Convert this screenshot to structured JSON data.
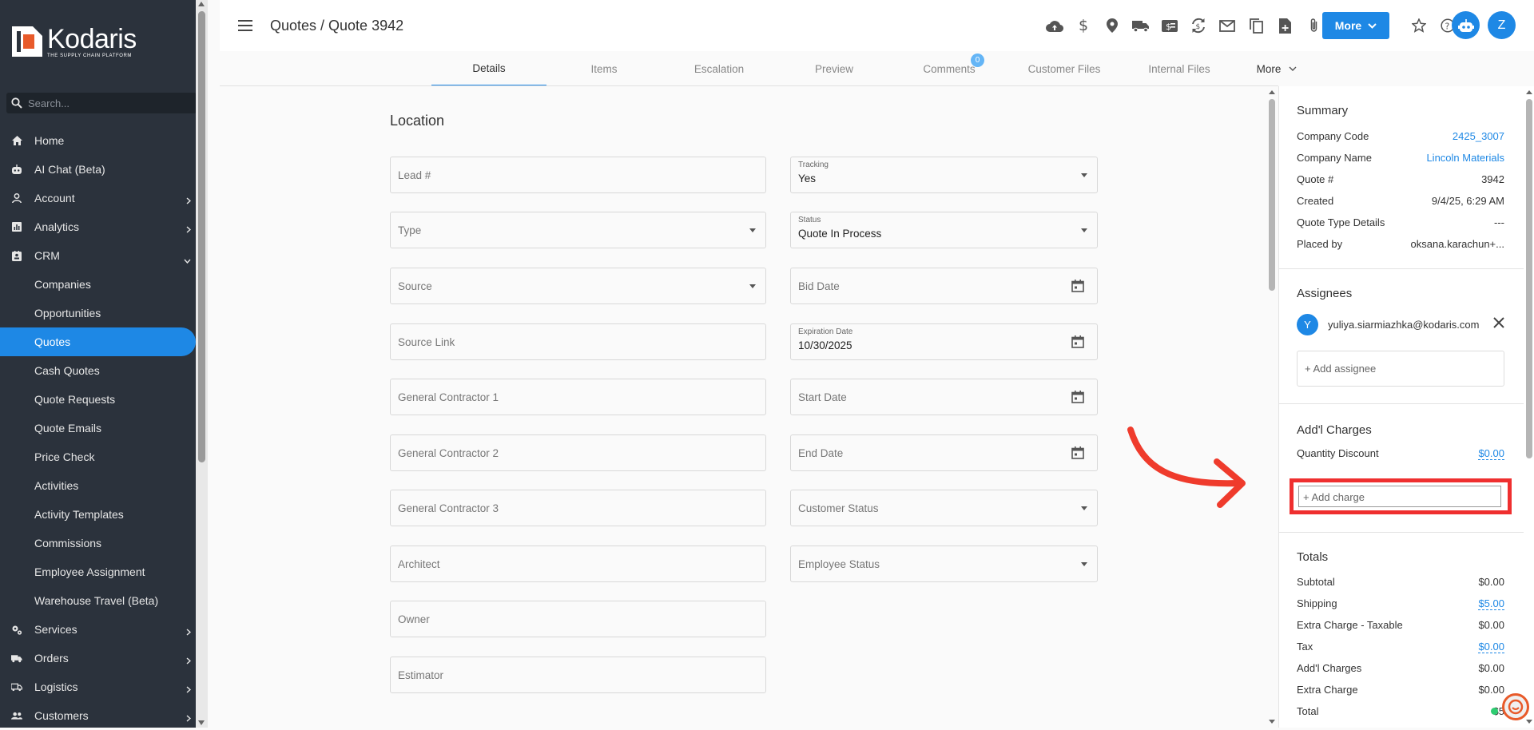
{
  "sidebar": {
    "logo_name": "Kodaris",
    "logo_tagline": "THE SUPPLY CHAIN PLATFORM",
    "search_placeholder": "Search...",
    "items": [
      {
        "label": "Home",
        "icon": "home-icon"
      },
      {
        "label": "AI Chat (Beta)",
        "icon": "robot-icon"
      },
      {
        "label": "Account",
        "icon": "person-icon"
      },
      {
        "label": "Analytics",
        "icon": "chart-icon"
      },
      {
        "label": "CRM",
        "icon": "contact-card-icon"
      }
    ],
    "crm_sub": [
      {
        "label": "Companies"
      },
      {
        "label": "Opportunities"
      },
      {
        "label": "Quotes"
      },
      {
        "label": "Cash Quotes"
      },
      {
        "label": "Quote Requests"
      },
      {
        "label": "Quote Emails"
      },
      {
        "label": "Price Check"
      },
      {
        "label": "Activities"
      },
      {
        "label": "Activity Templates"
      },
      {
        "label": "Commissions"
      },
      {
        "label": "Employee Assignment"
      },
      {
        "label": "Warehouse Travel (Beta)"
      }
    ],
    "items_after": [
      {
        "label": "Services",
        "icon": "gears-icon"
      },
      {
        "label": "Orders",
        "icon": "truck-icon"
      },
      {
        "label": "Logistics",
        "icon": "truck-icon"
      },
      {
        "label": "Customers",
        "icon": "people-icon"
      }
    ]
  },
  "header": {
    "title": "Quotes / Quote 3942",
    "more_label": "More",
    "avatar_initial": "Z"
  },
  "tabs": [
    {
      "label": "Details"
    },
    {
      "label": "Items"
    },
    {
      "label": "Escalation"
    },
    {
      "label": "Preview"
    },
    {
      "label": "Comments",
      "badge": "0"
    },
    {
      "label": "Customer Files"
    },
    {
      "label": "Internal Files"
    }
  ],
  "tabs_more": "More",
  "form": {
    "section_title": "Location",
    "left": [
      {
        "placeholder": "Lead #"
      },
      {
        "placeholder": "Type"
      },
      {
        "placeholder": "Source"
      },
      {
        "placeholder": "Source Link"
      },
      {
        "placeholder": "General Contractor 1"
      },
      {
        "placeholder": "General Contractor 2"
      },
      {
        "placeholder": "General Contractor 3"
      },
      {
        "placeholder": "Architect"
      },
      {
        "placeholder": "Owner"
      },
      {
        "placeholder": "Estimator"
      }
    ],
    "right": [
      {
        "label": "Tracking",
        "value": "Yes"
      },
      {
        "label": "Status",
        "value": "Quote In Process"
      },
      {
        "placeholder": "Bid Date"
      },
      {
        "label": "Expiration Date",
        "value": "10/30/2025"
      },
      {
        "placeholder": "Start Date"
      },
      {
        "placeholder": "End Date"
      },
      {
        "placeholder": "Customer Status"
      },
      {
        "placeholder": "Employee Status"
      }
    ]
  },
  "summary": {
    "title": "Summary",
    "rows": [
      {
        "k": "Company Code",
        "v": "2425_3007"
      },
      {
        "k": "Company Name",
        "v": "Lincoln Materials"
      },
      {
        "k": "Quote #",
        "v": "3942"
      },
      {
        "k": "Created",
        "v": "9/4/25, 6:29 AM"
      },
      {
        "k": "Quote Type Details",
        "v": "---"
      },
      {
        "k": "Placed by",
        "v": "oksana.karachun+..."
      }
    ]
  },
  "assignees": {
    "title": "Assignees",
    "initial": "Y",
    "email": "yuliya.siarmiazhka@kodaris.com",
    "add_placeholder": "+ Add assignee"
  },
  "charges": {
    "title": "Add'l Charges",
    "row_label": "Quantity Discount",
    "row_value": "$0.00",
    "add_placeholder": "+ Add charge"
  },
  "totals": {
    "title": "Totals",
    "rows": [
      {
        "k": "Subtotal",
        "v": "$0.00"
      },
      {
        "k": "Shipping",
        "v": "$5.00"
      },
      {
        "k": "Extra Charge - Taxable",
        "v": "$0.00"
      },
      {
        "k": "Tax",
        "v": "$0.00"
      },
      {
        "k": "Add'l Charges",
        "v": "$0.00"
      },
      {
        "k": "Extra Charge",
        "v": "$0.00"
      },
      {
        "k": "Total",
        "v": "$5"
      }
    ]
  },
  "colors": {
    "accent": "#1e88e5",
    "sidebar_bg": "#2b323c",
    "highlight": "#ef2f2f"
  }
}
